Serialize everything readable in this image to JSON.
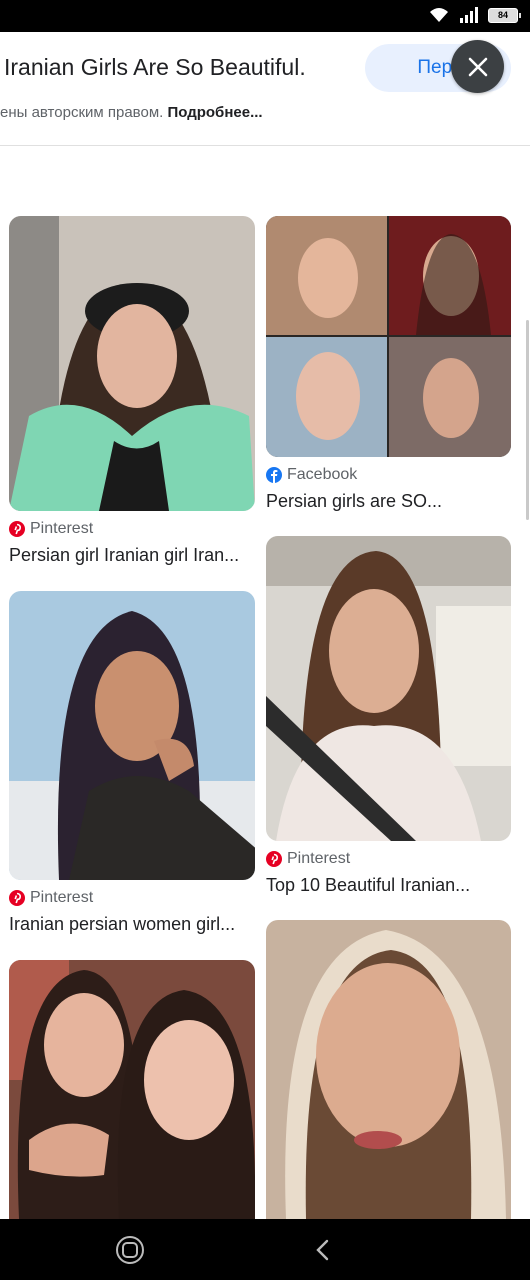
{
  "status_bar": {
    "battery": "84"
  },
  "header": {
    "title": "Iranian Girls Are So Beautiful.",
    "visit_label": "Перейти",
    "copyright_text": "ены авторским правом. ",
    "learn_more": "Подробнее..."
  },
  "results": [
    {
      "source": "Pinterest",
      "source_icon": "pinterest-icon",
      "caption": "Persian girl Iranian girl Iran..."
    },
    {
      "source": "Facebook",
      "source_icon": "facebook-icon",
      "caption": "Persian girls are SO..."
    },
    {
      "source": "Pinterest",
      "source_icon": "pinterest-icon",
      "caption": "Iranian persian women girl..."
    },
    {
      "source": "Pinterest",
      "source_icon": "pinterest-icon",
      "caption": "Top 10 Beautiful Iranian..."
    }
  ],
  "colors": {
    "accent": "#1a73e8",
    "pinterest": "#e60023",
    "facebook": "#1877f2"
  }
}
